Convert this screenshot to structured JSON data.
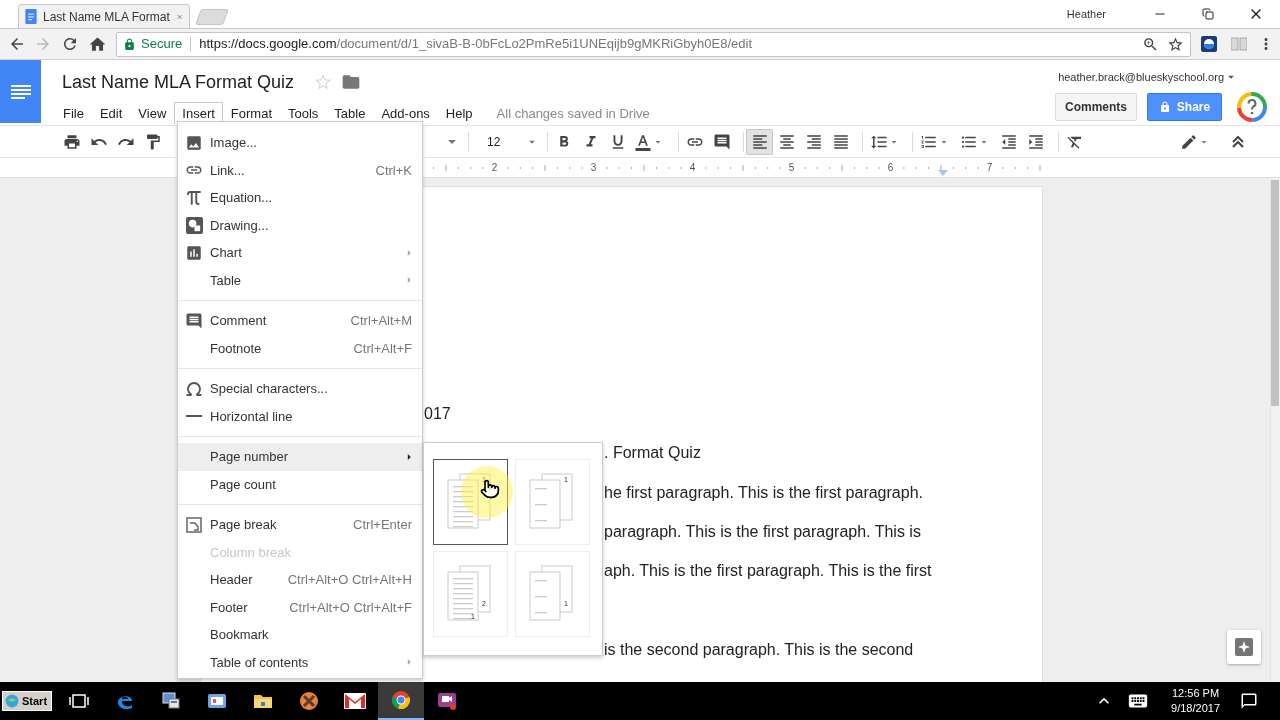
{
  "browser": {
    "tab_title": "Last Name MLA Format",
    "profile": "Heather",
    "secure_label": "Secure",
    "url_host": "https://docs.google.com",
    "url_path": "/document/d/1_sivaB-B-0bFcLo2PmRe5i1UNEqijb9gMKRiGbyh0E8/edit"
  },
  "doc": {
    "title": "Last Name MLA Format Quiz",
    "account": "heather.brack@blueskyschool.org",
    "save_status": "All changes saved in Drive",
    "comments_button": "Comments",
    "share_button": "Share",
    "menus": [
      {
        "label": "File",
        "selected": false
      },
      {
        "label": "Edit",
        "selected": false
      },
      {
        "label": "View",
        "selected": false
      },
      {
        "label": "Insert",
        "selected": true
      },
      {
        "label": "Format",
        "selected": false
      },
      {
        "label": "Tools",
        "selected": false
      },
      {
        "label": "Table",
        "selected": false
      },
      {
        "label": "Add-ons",
        "selected": false
      },
      {
        "label": "Help",
        "selected": false
      }
    ]
  },
  "toolbar": [
    {
      "kind": "print",
      "selected": false
    },
    {
      "kind": "undo",
      "selected": false
    },
    {
      "kind": "redo",
      "selected": false
    },
    {
      "kind": "paint_format",
      "selected": false
    },
    {
      "kind": "font_caret",
      "selected": false
    },
    {
      "kind": "font_size",
      "value": "12",
      "selected": false
    },
    {
      "kind": "bold",
      "selected": false
    },
    {
      "kind": "italic",
      "selected": false
    },
    {
      "kind": "underline",
      "selected": false
    },
    {
      "kind": "text_color",
      "selected": false
    },
    {
      "kind": "link",
      "selected": false
    },
    {
      "kind": "comment",
      "selected": false
    },
    {
      "kind": "align_left",
      "selected": true
    },
    {
      "kind": "align_center",
      "selected": false
    },
    {
      "kind": "align_right",
      "selected": false
    },
    {
      "kind": "align_justify",
      "selected": false
    },
    {
      "kind": "line_spacing",
      "selected": false
    },
    {
      "kind": "numbered_list",
      "selected": false
    },
    {
      "kind": "bulleted_list",
      "selected": false
    },
    {
      "kind": "indent_decrease",
      "selected": false
    },
    {
      "kind": "indent_increase",
      "selected": false
    },
    {
      "kind": "clear_format",
      "selected": false
    },
    {
      "kind": "edit_mode",
      "selected": false
    },
    {
      "kind": "collapse",
      "selected": false
    }
  ],
  "ruler": {
    "numbers": [
      "2",
      "3",
      "4",
      "5",
      "6",
      "7"
    ]
  },
  "document": {
    "lines": [
      {
        "text": "017",
        "kind": "after_menu",
        "blank_before": false
      },
      {
        "text": ". Format Quiz",
        "kind": "after_submenu",
        "blank_before": false
      },
      {
        "text": "he first paragraph. This is the first paragraph.",
        "kind": "after_submenu",
        "blank_before": false
      },
      {
        "text": "paragraph. This is the first paragraph. This is",
        "kind": "after_submenu",
        "blank_before": false
      },
      {
        "text": "aph. This is the first paragraph. This is the first",
        "kind": "after_submenu",
        "blank_before": false
      },
      {
        "text": "is the second paragraph. This is the second",
        "kind": "after_submenu",
        "blank_before": true
      }
    ]
  },
  "insert_menu": {
    "sections": [
      {
        "items": [
          {
            "label": "Image...",
            "kind": "image",
            "submenu": false,
            "selected": false,
            "disabled": false
          },
          {
            "label": "Link...",
            "kind": "link",
            "shortcut": "Ctrl+K",
            "submenu": false,
            "selected": false,
            "disabled": false
          },
          {
            "label": "Equation...",
            "kind": "equation",
            "submenu": false,
            "selected": false,
            "disabled": false
          },
          {
            "label": "Drawing...",
            "kind": "drawing",
            "submenu": false,
            "selected": false,
            "disabled": false
          },
          {
            "label": "Chart",
            "kind": "chart",
            "submenu": true,
            "selected": false,
            "disabled": false
          },
          {
            "label": "Table",
            "submenu": true,
            "selected": false,
            "disabled": false
          }
        ]
      },
      {
        "items": [
          {
            "label": "Comment",
            "kind": "comment",
            "shortcut": "Ctrl+Alt+M",
            "submenu": false,
            "selected": false,
            "disabled": false
          },
          {
            "label": "Footnote",
            "shortcut": "Ctrl+Alt+F",
            "submenu": false,
            "selected": false,
            "disabled": false
          }
        ]
      },
      {
        "items": [
          {
            "label": "Special characters...",
            "kind": "omega",
            "submenu": false,
            "selected": false,
            "disabled": false
          },
          {
            "label": "Horizontal line",
            "kind": "hline",
            "submenu": false,
            "selected": false,
            "disabled": false
          }
        ]
      },
      {
        "items": [
          {
            "label": "Page number",
            "submenu": true,
            "selected": true,
            "disabled": false
          },
          {
            "label": "Page count",
            "submenu": false,
            "selected": false,
            "disabled": false
          }
        ]
      },
      {
        "items": [
          {
            "label": "Page break",
            "kind": "page_break",
            "shortcut": "Ctrl+Enter",
            "submenu": false,
            "selected": false,
            "disabled": false
          },
          {
            "label": "Column break",
            "submenu": false,
            "selected": false,
            "disabled": true
          },
          {
            "label": "Header",
            "shortcut": "Ctrl+Alt+O Ctrl+Alt+H",
            "submenu": false,
            "selected": false,
            "disabled": false
          },
          {
            "label": "Footer",
            "shortcut": "Ctrl+Alt+O Ctrl+Alt+F",
            "submenu": false,
            "selected": false,
            "disabled": false
          },
          {
            "label": "Bookmark",
            "submenu": false,
            "selected": false,
            "disabled": false
          },
          {
            "label": "Table of contents",
            "submenu": true,
            "selected": false,
            "disabled": false
          }
        ]
      }
    ]
  },
  "page_number_options": [
    {
      "kind": "top_all",
      "labels": [
        "1"
      ],
      "selected": true
    },
    {
      "kind": "top_skip_first",
      "labels": [
        "1"
      ],
      "selected": false
    },
    {
      "kind": "bottom_all",
      "labels": [
        "1",
        "2"
      ],
      "selected": false
    },
    {
      "kind": "bottom_skip_first",
      "labels": [
        "1"
      ],
      "selected": false
    }
  ],
  "taskbar": {
    "start": "Start",
    "time": "12:56 PM",
    "date": "9/18/2017",
    "apps": [
      {
        "kind": "task_view",
        "selected": false
      },
      {
        "kind": "edge",
        "selected": false
      },
      {
        "kind": "remote",
        "selected": false
      },
      {
        "kind": "calendar",
        "selected": false
      },
      {
        "kind": "files",
        "selected": false
      },
      {
        "kind": "orange_app",
        "selected": false
      },
      {
        "kind": "mail",
        "selected": false
      },
      {
        "kind": "chrome",
        "selected": true
      },
      {
        "kind": "video_app",
        "selected": false
      }
    ]
  }
}
